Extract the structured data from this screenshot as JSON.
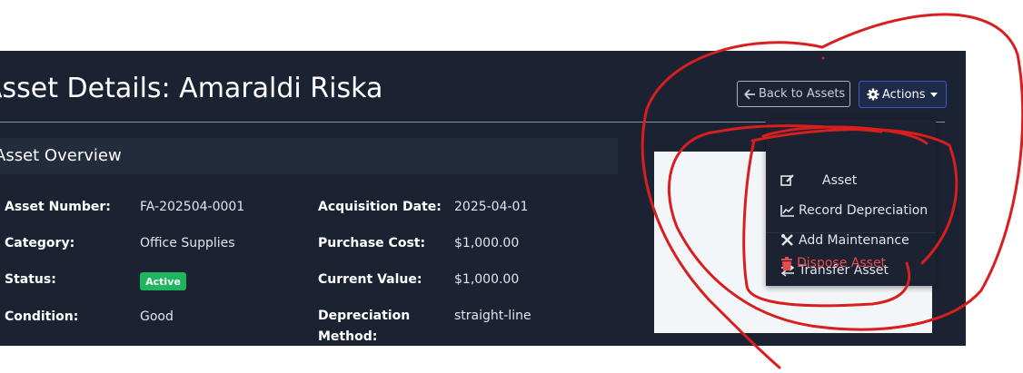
{
  "page": {
    "title": "Asset Details: Amaraldi Riska"
  },
  "header": {
    "back_label": "Back to Assets",
    "actions_label": "Actions"
  },
  "overview": {
    "title": "Asset Overview",
    "asset_number_label": "Asset Number:",
    "asset_number_value": "FA-202504-0001",
    "category_label": "Category:",
    "category_value": "Office Supplies",
    "status_label": "Status:",
    "status_badge": "Active",
    "condition_label": "Condition:",
    "condition_value": "Good",
    "acquisition_date_label": "Acquisition Date:",
    "acquisition_date_value": "2025-04-01",
    "purchase_cost_label": "Purchase Cost:",
    "purchase_cost_value": "$1,000.00",
    "current_value_label": "Current Value:",
    "current_value_value": "$1,000.00",
    "depreciation_method_label_1": "Depreciation",
    "depreciation_method_label_2": "Method:",
    "depreciation_method_value": "straight-line"
  },
  "dropdown": {
    "edit_asset_partial": "Asset",
    "record_depreciation": "Record Depreciation",
    "add_maintenance": "Add Maintenance",
    "transfer_asset": "Transfer Asset",
    "dispose_asset": "Dispose Asset"
  },
  "colors": {
    "background": "#1b2332",
    "header_bg": "#232c3c",
    "badge_active": "#1fb55e",
    "danger": "#e74c4c",
    "actions_border": "#3d57c2",
    "annotation_red": "#d81e1e"
  }
}
